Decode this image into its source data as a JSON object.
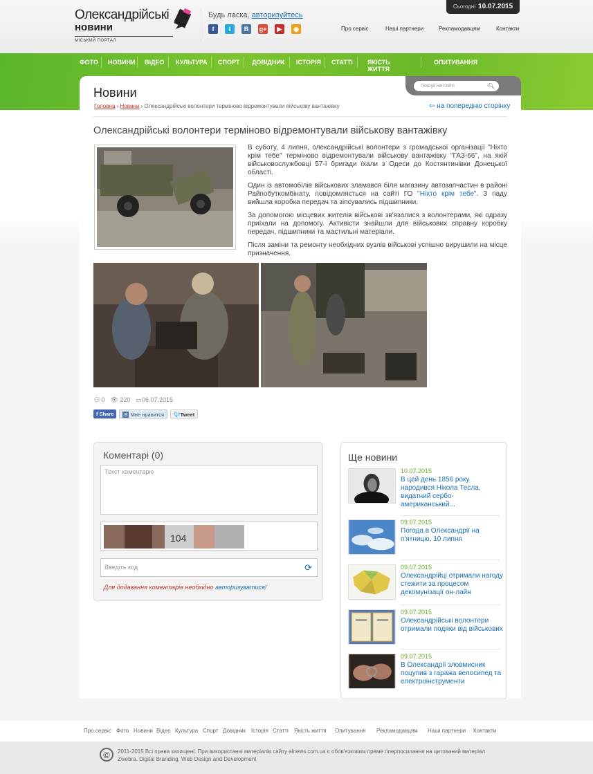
{
  "header": {
    "logo_line1": "Олександрійські",
    "logo_line2": "новини",
    "logo_sub": "МІСЬКИЙ ПОРТАЛ",
    "login_prompt": "Будь ласка, ",
    "login_link": "авторизуйтесь",
    "social": [
      {
        "icon": "facebook-icon",
        "glyph": "f",
        "color": "#3b5998"
      },
      {
        "icon": "twitter-icon",
        "glyph": "t",
        "color": "#2aa9e0"
      },
      {
        "icon": "vkontakte-icon",
        "glyph": "B",
        "color": "#4c75a3"
      },
      {
        "icon": "google-plus-icon",
        "glyph": "g+",
        "color": "#dd4b39"
      },
      {
        "icon": "youtube-icon",
        "glyph": "▶",
        "color": "#c4302b"
      },
      {
        "icon": "rss-icon",
        "glyph": "◉",
        "color": "#f39c12"
      }
    ],
    "topnav": [
      "Про сервіс",
      "Наші партнери",
      "Рекламодавцям",
      "Контакти"
    ],
    "today_label": "Сьогодні",
    "today_date": "10.07.2015"
  },
  "menu": [
    "ФОТО",
    "НОВИНИ",
    "ВІДЕО",
    "КУЛЬТУРА",
    "СПОРТ",
    "ДОВІДНИК",
    "ІСТОРІЯ",
    "СТАТТІ",
    "ЯКІСТЬ ЖИТТЯ",
    "ОПИТУВАННЯ"
  ],
  "search": {
    "placeholder": "Пошук на сайті"
  },
  "page": {
    "title": "Новини",
    "crumbs": [
      "Головна",
      "Новини",
      "Олександрійські волонтери терміново відремонтували військову вантажівку"
    ],
    "back": "на попередню сторінку"
  },
  "article": {
    "title": "Олександрійські волонтери терміново відремонтували військову вантажівку",
    "p1": "В суботу, 4 липня, олександрійські волонтери з громадської організації \"Ніхто крім тебе\" терміново відремонтували військову вантажівку \"ГАЗ-66\", на якій військовослужбовці 57-ї бригади їхали з Одеси до Костянтинівки Донецької області.",
    "p2a": "Один із автомобілів військових зламався біля магазину автозапчастин в районі Райпобуткомбінату, повідомляється на сайті ГО ",
    "p2link": "\"Ніхто крім тебе\"",
    "p2b": ". З паду вийшла коробка передач та зіпсувались підшипники.",
    "p3": "За допомогою місцевих жителів військові зв'язалися з волонтерами, які одразу приїхали на допомогу. Активісти знайшли для військових справну коробку передач, підшипники та мастильні матеріали.",
    "p4": "Після заміни та ремонту необхідних вузлів військові успішно вирушили на місце призначення.",
    "comments_count": "0",
    "views": "220",
    "date": "06.07.2015",
    "share_fb": "Share",
    "share_vk": "Мне нравится",
    "share_tw": "Tweet"
  },
  "comments": {
    "title": "Коментарі (0)",
    "text_placeholder": "Текст коментарю",
    "captcha_text": "104",
    "code_placeholder": "Введіть код",
    "note": "Для додавання коментарів необхідно ",
    "note_link": "авторизуватися!"
  },
  "more_news": {
    "title": "Ще новини",
    "items": [
      {
        "date": "10.07.2015",
        "title": "В цей день 1856 року народився Нікола Тесла, видатний сербо-американський..."
      },
      {
        "date": "09.07.2015",
        "title": "Погода в Олександрії на п'ятницю, 10 липня"
      },
      {
        "date": "09.07.2015",
        "title": "Олександрійці отримали нагоду стежити за процесом декомунізації он-лайн"
      },
      {
        "date": "09.07.2015",
        "title": "Олександрійські волонтери отримали подяки від військових"
      },
      {
        "date": "09.07.2015",
        "title": "В Олександрії зловмисник поцупив з гаража велосипед та електроінструменти"
      }
    ]
  },
  "footer": {
    "nav": [
      "Про сервіс",
      "Фото",
      "Новини",
      "Відео",
      "Культура",
      "Спорт",
      "Довідник",
      "Історія",
      "Статті",
      "Якість життя",
      "Опитування",
      "Рекламодавцям",
      "Наші партнери",
      "Контакти"
    ],
    "copyright": "2011-2015 Всі права захищені. При використанні матеріалів сайту alnews.com.ua є обов'язковим пряме гіперпосилання на цитований матеріал",
    "credits": "Zwebra. Digital Branding, Web Design and Development"
  }
}
